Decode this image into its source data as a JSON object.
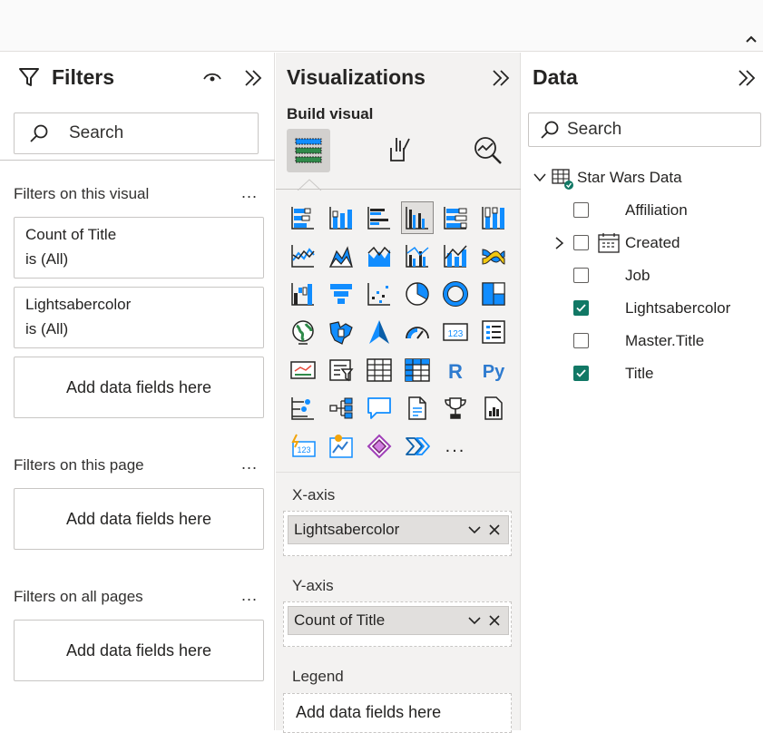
{
  "filters": {
    "title": "Filters",
    "search_placeholder": "Search",
    "section_visual": "Filters on this visual",
    "section_page": "Filters on this page",
    "section_all": "Filters on all pages",
    "more": "...",
    "cards": [
      {
        "field": "Count of Title",
        "condition": "is (All)"
      },
      {
        "field": "Lightsabercolor",
        "condition": "is (All)"
      }
    ],
    "add_fields": "Add data fields here"
  },
  "viz": {
    "title": "Visualizations",
    "build_label": "Build visual",
    "more_label": "...",
    "r_label": "R",
    "py_label": "Py",
    "kpi_label": "123",
    "xaxis_label": "X-axis",
    "xaxis_field": "Lightsabercolor",
    "yaxis_label": "Y-axis",
    "yaxis_field": "Count of Title",
    "legend_label": "Legend",
    "add_fields": "Add data fields here"
  },
  "data": {
    "title": "Data",
    "search_placeholder": "Search",
    "table_name": "Star Wars Data",
    "fields": [
      {
        "name": "Affiliation",
        "checked": false
      },
      {
        "name": "Created",
        "checked": false
      },
      {
        "name": "Job",
        "checked": false
      },
      {
        "name": "Lightsabercolor",
        "checked": true
      },
      {
        "name": "Master.Title",
        "checked": false
      },
      {
        "name": "Title",
        "checked": true
      }
    ]
  },
  "colors": {
    "accent_teal": "#117865",
    "icon_blue": "#118dff",
    "icon_dark": "#252423",
    "panel_gray": "#f3f2f1"
  }
}
